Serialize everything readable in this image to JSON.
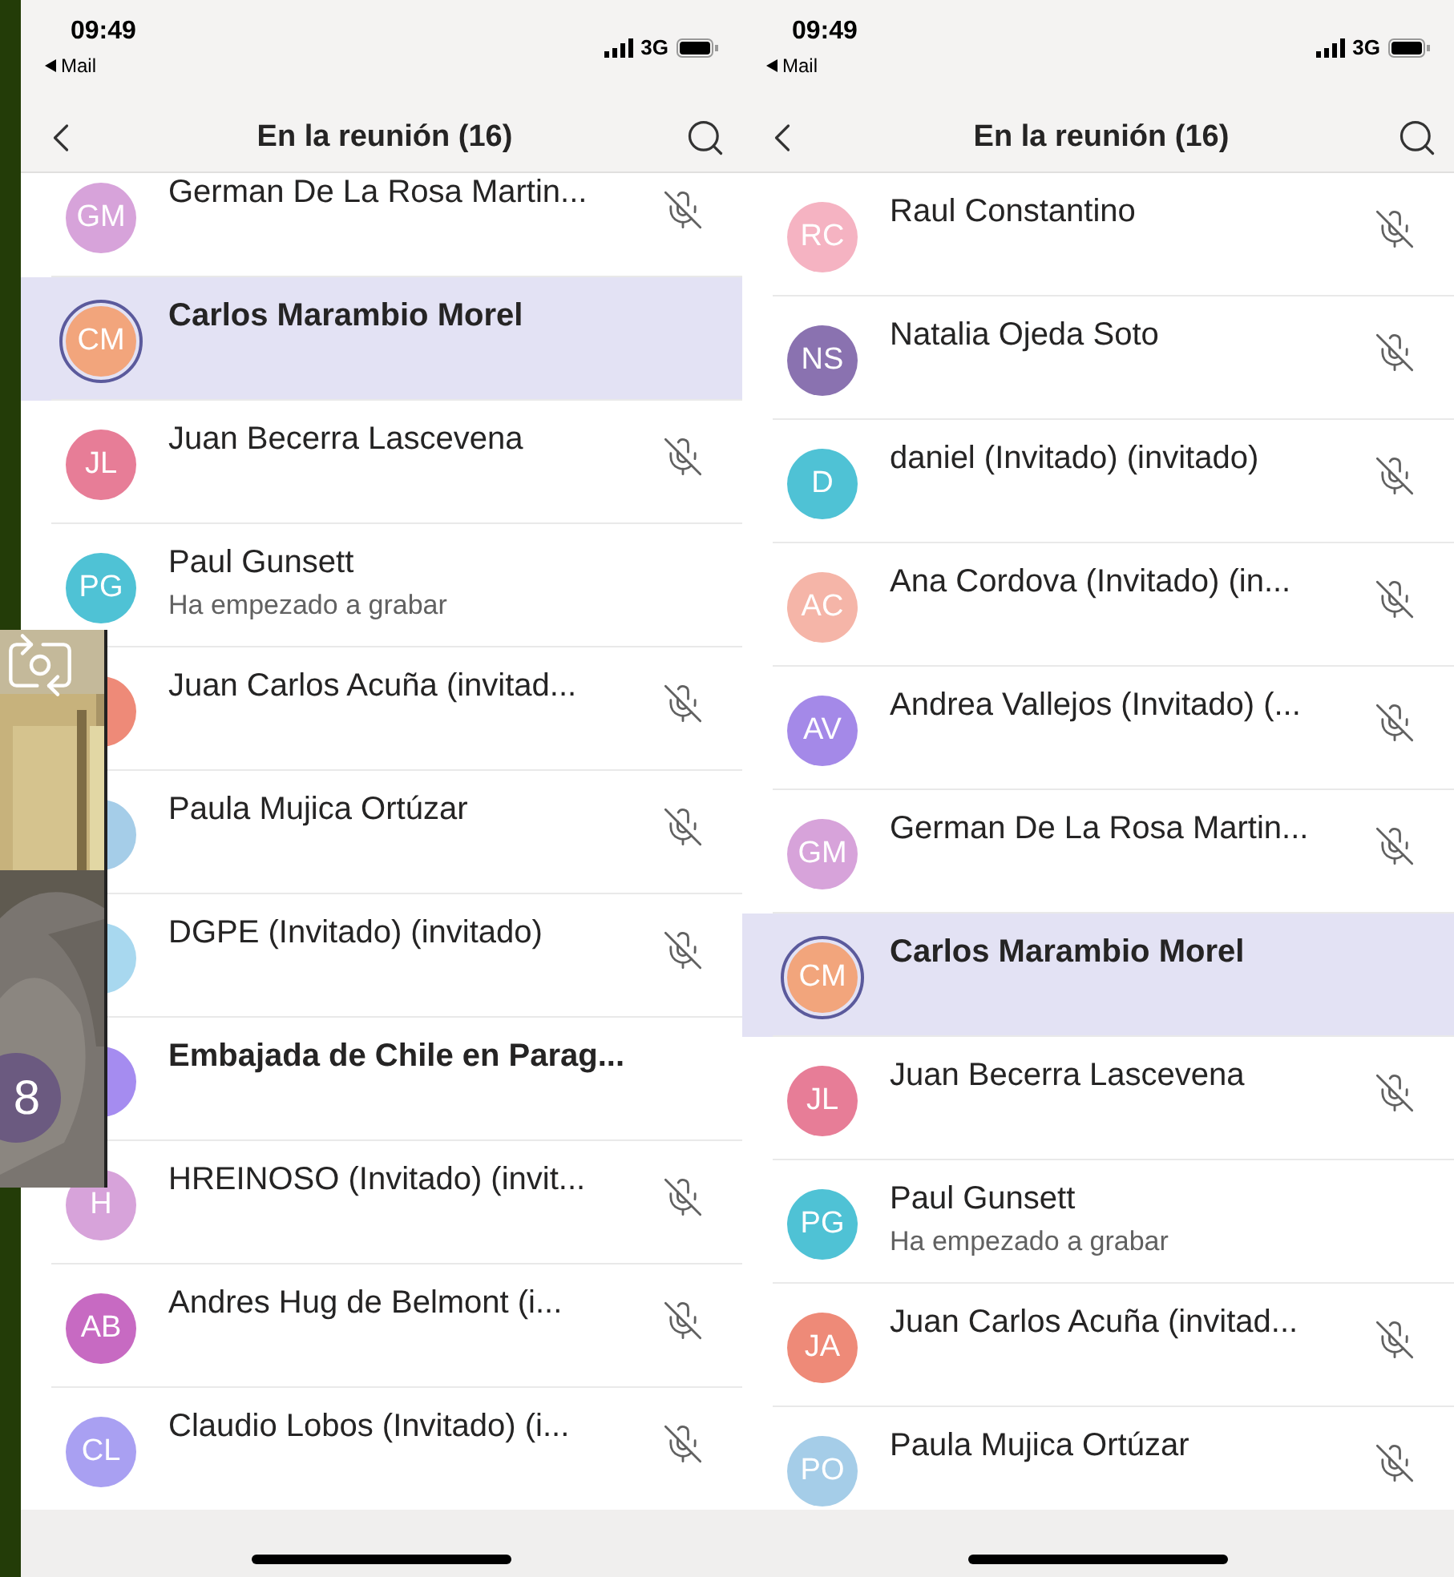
{
  "screens": [
    {
      "status_bar": {
        "time": "09:49",
        "back_app": "Mail",
        "network": "3G"
      },
      "title": "En la reunión (16)",
      "scrolled": true,
      "participants": [
        {
          "name": "German De La Rosa Martin...",
          "initials": "GM",
          "color": "#d7a3da",
          "muted": true,
          "highlighted": false,
          "bold": false
        },
        {
          "name": "Carlos Marambio Morel",
          "initials": "CM",
          "color": "#f2a57c",
          "muted": false,
          "highlighted": true,
          "bold": true
        },
        {
          "name": "Juan Becerra Lascevena",
          "initials": "JL",
          "color": "#e77d97",
          "muted": true,
          "highlighted": false,
          "bold": false
        },
        {
          "name": "Paul Gunsett",
          "subtitle": "Ha empezado a grabar",
          "initials": "PG",
          "color": "#4fc2d5",
          "muted": false,
          "highlighted": false,
          "bold": false
        },
        {
          "name": "Juan Carlos Acuña (invitad...",
          "color": "#ee8a78",
          "muted": true,
          "highlighted": false,
          "bold": false
        },
        {
          "name": "Paula Mujica Ortúzar",
          "color": "#a5cde8",
          "muted": true,
          "highlighted": false,
          "bold": false
        },
        {
          "name": "DGPE (Invitado) (invitado)",
          "color": "#a8d8ef",
          "muted": true,
          "highlighted": false,
          "bold": false
        },
        {
          "name": "Embajada de Chile en Parag...",
          "color": "#a58cf0",
          "muted": false,
          "highlighted": false,
          "bold": true
        },
        {
          "name": "HREINOSO (Invitado) (invit...",
          "initials": "H",
          "color": "#d7a3da",
          "muted": true,
          "highlighted": false,
          "bold": false
        },
        {
          "name": "Andres  Hug de Belmont (i...",
          "initials": "AB",
          "color": "#c76ac2",
          "muted": true,
          "highlighted": false,
          "bold": false
        },
        {
          "name": "Claudio Lobos (Invitado) (i...",
          "initials": "CL",
          "color": "#a9a0f2",
          "muted": true,
          "highlighted": false,
          "bold": false
        }
      ]
    },
    {
      "status_bar": {
        "time": "09:49",
        "back_app": "Mail",
        "network": "3G"
      },
      "title": "En la reunión (16)",
      "scrolled": false,
      "participants": [
        {
          "name": "Raul Constantino",
          "initials": "RC",
          "color": "#f5b3c2",
          "muted": true,
          "highlighted": false,
          "bold": false
        },
        {
          "name": "Natalia Ojeda Soto",
          "initials": "NS",
          "color": "#8a72b0",
          "muted": true,
          "highlighted": false,
          "bold": false
        },
        {
          "name": "daniel (Invitado) (invitado)",
          "initials": "D",
          "color": "#4fc2d5",
          "muted": true,
          "highlighted": false,
          "bold": false
        },
        {
          "name": "Ana Cordova (Invitado) (in...",
          "initials": "AC",
          "color": "#f5b5a8",
          "muted": true,
          "highlighted": false,
          "bold": false
        },
        {
          "name": "Andrea Vallejos (Invitado) (...",
          "initials": "AV",
          "color": "#a489e8",
          "muted": true,
          "highlighted": false,
          "bold": false
        },
        {
          "name": "German De La Rosa Martin...",
          "initials": "GM",
          "color": "#d7a3da",
          "muted": true,
          "highlighted": false,
          "bold": false
        },
        {
          "name": "Carlos Marambio Morel",
          "initials": "CM",
          "color": "#f2a57c",
          "muted": false,
          "highlighted": true,
          "bold": true
        },
        {
          "name": "Juan Becerra Lascevena",
          "initials": "JL",
          "color": "#e77d97",
          "muted": true,
          "highlighted": false,
          "bold": false
        },
        {
          "name": "Paul Gunsett",
          "subtitle": "Ha empezado a grabar",
          "initials": "PG",
          "color": "#4fc2d5",
          "muted": false,
          "highlighted": false,
          "bold": false
        },
        {
          "name": "Juan Carlos Acuña (invitad...",
          "initials": "JA",
          "color": "#ee8a78",
          "muted": true,
          "highlighted": false,
          "bold": false
        },
        {
          "name": "Paula Mujica Ortúzar",
          "initials": "PO",
          "color": "#a5cde8",
          "muted": true,
          "highlighted": false,
          "bold": false
        }
      ]
    }
  ],
  "video_overlay": {
    "kind": "picture",
    "badge": "8"
  }
}
